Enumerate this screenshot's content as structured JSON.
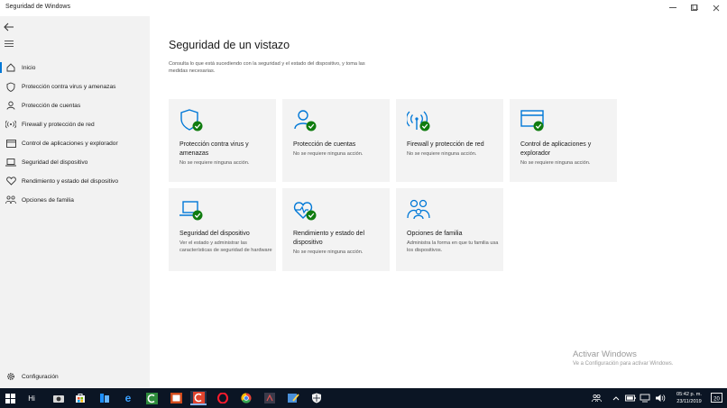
{
  "window": {
    "title": "Seguridad de Windows"
  },
  "sidebar": {
    "items": [
      {
        "label": "Inicio",
        "icon": "home-icon"
      },
      {
        "label": "Protección contra virus y amenazas",
        "icon": "shield-icon"
      },
      {
        "label": "Protección de cuentas",
        "icon": "person-icon"
      },
      {
        "label": "Firewall y protección de red",
        "icon": "wifi-antenna-icon"
      },
      {
        "label": "Control de aplicaciones y explorador",
        "icon": "browser-icon"
      },
      {
        "label": "Seguridad del dispositivo",
        "icon": "laptop-icon"
      },
      {
        "label": "Rendimiento y estado del dispositivo",
        "icon": "heart-icon"
      },
      {
        "label": "Opciones de familia",
        "icon": "family-icon"
      }
    ],
    "settings_label": "Configuración"
  },
  "main": {
    "title": "Seguridad de un vistazo",
    "subtitle": "Consulta lo que está sucediendo con la seguridad y el estado del dispositivo, y toma las medidas necesarias.",
    "tiles": [
      {
        "title": "Protección contra virus y amenazas",
        "status": "No se requiere ninguna acción.",
        "icon": "shield-check-icon"
      },
      {
        "title": "Protección de cuentas",
        "status": "No se requiere ninguna acción.",
        "icon": "person-check-icon"
      },
      {
        "title": "Firewall y protección de red",
        "status": "No se requiere ninguna acción.",
        "icon": "antenna-check-icon"
      },
      {
        "title": "Control de aplicaciones y explorador",
        "status": "No se requiere ninguna acción.",
        "icon": "browser-check-icon"
      },
      {
        "title": "Seguridad del dispositivo",
        "status": "Ver el estado y administrar las características de seguridad de hardware",
        "icon": "laptop-check-icon"
      },
      {
        "title": "Rendimiento y estado del dispositivo",
        "status": "No se requiere ninguna acción.",
        "icon": "heart-check-icon"
      },
      {
        "title": "Opciones de familia",
        "status": "Administra la forma en que tu familia usa los dispositivos.",
        "icon": "family-icon"
      }
    ]
  },
  "watermark": {
    "line1": "Activar Windows",
    "line2": "Ve a Configuración para activar Windows."
  },
  "taskbar": {
    "search_label": "Hi",
    "time": "05:42 p. m.",
    "date": "23/11/2019",
    "notification_count": "20"
  },
  "colors": {
    "accent": "#0078d7",
    "ok_green": "#107c10",
    "taskbar": "#0b1524",
    "sidebar": "#f2f2f2",
    "tile": "#f3f3f3"
  }
}
